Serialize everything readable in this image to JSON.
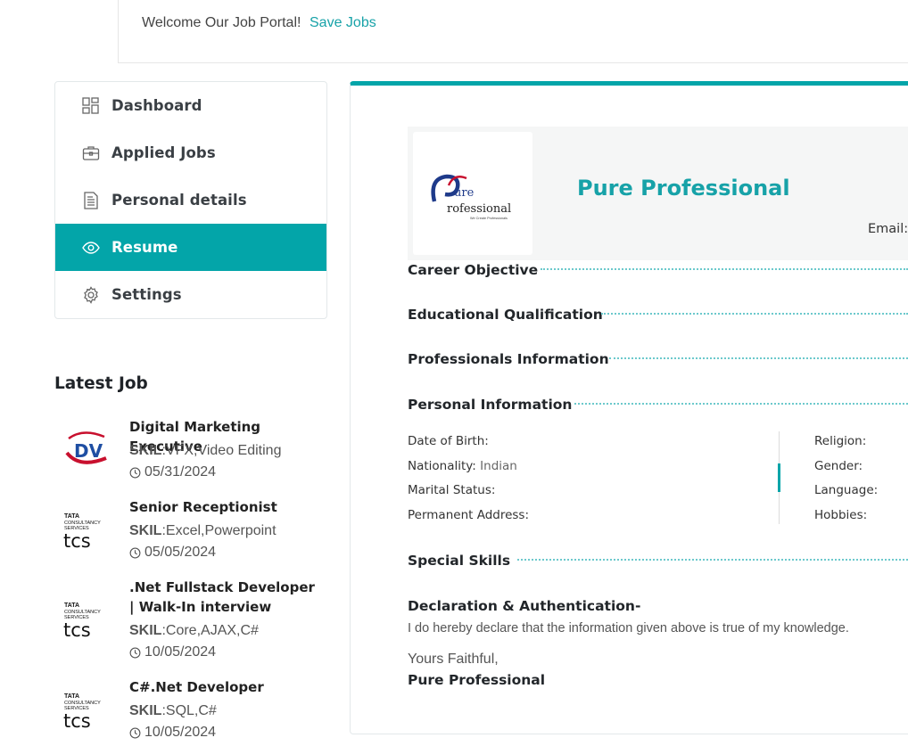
{
  "topbar": {
    "welcome": "Welcome Our Job Portal!",
    "save_jobs": "Save Jobs"
  },
  "sidebar": {
    "items": [
      {
        "label": "Dashboard",
        "icon": "dashboard-icon"
      },
      {
        "label": "Applied Jobs",
        "icon": "briefcase-icon"
      },
      {
        "label": "Personal details",
        "icon": "document-icon"
      },
      {
        "label": "Resume",
        "icon": "eye-icon",
        "active": true
      },
      {
        "label": "Settings",
        "icon": "gear-icon"
      }
    ]
  },
  "latest": {
    "title": "Latest Job",
    "skil_label": "SKIL",
    "jobs": [
      {
        "title": "Digital Marketing Executive",
        "skills": ":VFX,Video Editing",
        "date": "05/31/2024",
        "logo": "dv-logo"
      },
      {
        "title": "Senior Receptionist",
        "skills": ":Excel,Powerpoint",
        "date": "05/05/2024",
        "logo": "tcs-logo"
      },
      {
        "title": ".Net Fullstack Developer | Walk-In interview",
        "skills": ":Core,AJAX,C#",
        "date": "10/05/2024",
        "logo": "tcs-logo"
      },
      {
        "title": "C#.Net Developer",
        "skills": ":SQL,C#",
        "date": "10/05/2024",
        "logo": "tcs-logo"
      }
    ],
    "tcs_brand": {
      "line1": "TATA",
      "line2": "CONSULTANCY",
      "line3": "SERVICES",
      "mark": "tcs"
    },
    "dv_brand": "DV"
  },
  "resume": {
    "company": "Pure Professional",
    "logo_text": {
      "line1": "ure",
      "line2": "rofessional",
      "tag": "We Create Professionals"
    },
    "email_label": "Email:",
    "sections": {
      "career": "Career Objective",
      "education": "Educational Qualification",
      "professional": "Professionals Information",
      "personal": "Personal Information",
      "skills": "Special Skills",
      "declaration": "Declaration & Authentication-"
    },
    "personal": {
      "dob": "Date of Birth:",
      "nationality": "Nationality:",
      "nationality_value": "Indian",
      "marital": "Marital Status:",
      "address": "Permanent Address:",
      "religion": "Religion:",
      "gender": "Gender:",
      "language": "Language:",
      "hobbies": "Hobbies:"
    },
    "declaration_text": "I do hereby declare that the information given above is true of my knowledge.",
    "yours": "Yours Faithful,",
    "signature": "Pure Professional"
  },
  "colors": {
    "accent": "#03a5a9",
    "link": "#17a2a8",
    "dots": "#6cc9cc"
  }
}
